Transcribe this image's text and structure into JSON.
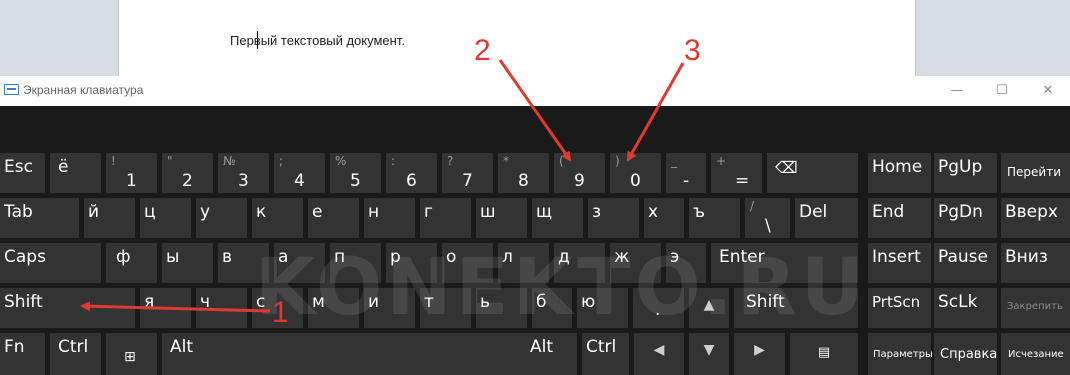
{
  "document": {
    "text": "Первый текстовый документ."
  },
  "window": {
    "title": "Экранная клавиатура",
    "minimize": "—",
    "maximize": "☐",
    "close": "✕"
  },
  "keys": {
    "esc": "Esc",
    "yo": "ё",
    "n1": {
      "up": "!",
      "low": "1"
    },
    "n2": {
      "up": "\"",
      "low": "2"
    },
    "n3": {
      "up": "№",
      "low": "3"
    },
    "n4": {
      "up": ";",
      "low": "4"
    },
    "n5": {
      "up": "%",
      "low": "5"
    },
    "n6": {
      "up": ":",
      "low": "6"
    },
    "n7": {
      "up": "?",
      "low": "7"
    },
    "n8": {
      "up": "*",
      "low": "8"
    },
    "n9": {
      "up": "(",
      "low": "9"
    },
    "n0": {
      "up": ")",
      "low": "0"
    },
    "minus": {
      "up": "_",
      "low": "-"
    },
    "plus": {
      "up": "+",
      "low": "="
    },
    "backspace": "⌫",
    "tab": "Tab",
    "q": "й",
    "w": "ц",
    "e": "у",
    "r": "к",
    "t": "е",
    "y": "н",
    "u": "г",
    "i": "ш",
    "o": "щ",
    "p": "з",
    "lb": "х",
    "rb": "ъ",
    "bslash": {
      "up": "/",
      "low": "\\"
    },
    "del": "Del",
    "caps": "Caps",
    "a": "ф",
    "s": "ы",
    "d": "в",
    "f": "а",
    "g": "п",
    "h": "р",
    "j": "о",
    "k": "л",
    "l": "д",
    "semi": "ж",
    "quote": "э",
    "enter": "Enter",
    "shift": "Shift",
    "z": "я",
    "x": "ч",
    "c": "с",
    "v": "м",
    "b": "и",
    "n": "т",
    "m": "ь",
    "comma": "б",
    "period": "ю",
    "slash": ".",
    "up": "▲",
    "rshift": "Shift",
    "fn": "Fn",
    "ctrl": "Ctrl",
    "win": "⊞",
    "alt": "Alt",
    "altgr": "Alt",
    "rctrl": "Ctrl",
    "left": "◀",
    "down": "▼",
    "right": "▶",
    "menu": "▤",
    "home": "Home",
    "pgup": "PgUp",
    "go": "Перейти",
    "end": "End",
    "pgdn": "PgDn",
    "vverh": "Вверх",
    "insert": "Insert",
    "pause": "Pause",
    "vniz": "Вниз",
    "prtscn": "PrtScn",
    "sclk": "ScLk",
    "zakrepit": "Закрепить",
    "params": "Параметры",
    "help": "Справка",
    "fade": "Исчезание"
  },
  "watermark": "KONEKTO.RU",
  "annotations": {
    "label1": "1",
    "label2": "2",
    "label3": "3",
    "color": "#e03a30"
  }
}
